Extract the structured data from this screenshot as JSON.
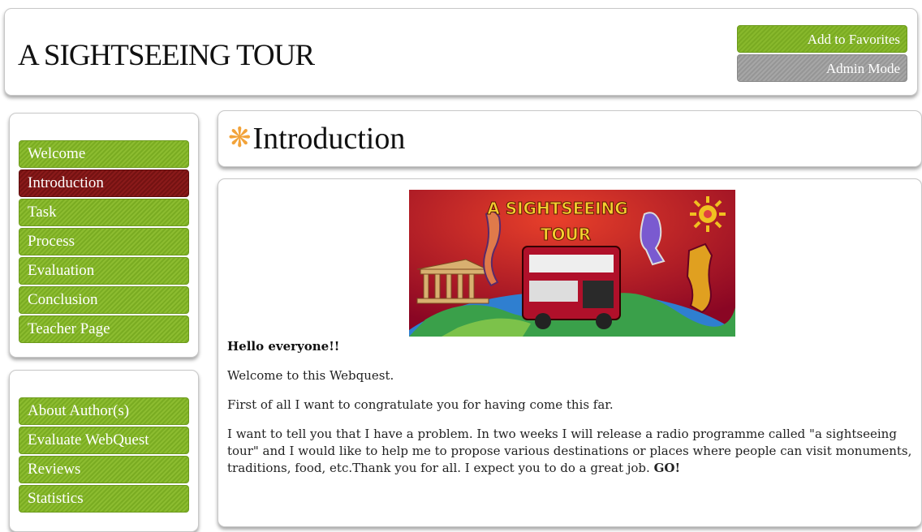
{
  "header": {
    "title": "A SIGHTSEEING TOUR",
    "add_favorites": "Add to Favorites",
    "admin_mode": "Admin Mode"
  },
  "nav_main": [
    {
      "label": "Welcome"
    },
    {
      "label": "Introduction",
      "active": true
    },
    {
      "label": "Task"
    },
    {
      "label": "Process"
    },
    {
      "label": "Evaluation"
    },
    {
      "label": "Conclusion"
    },
    {
      "label": "Teacher Page"
    }
  ],
  "nav_extra": [
    {
      "label": "About Author(s)"
    },
    {
      "label": "Evaluate WebQuest"
    },
    {
      "label": "Reviews"
    },
    {
      "label": "Statistics"
    }
  ],
  "page": {
    "heading": "Introduction",
    "banner_line1": "A SIGHTSEEING",
    "banner_line2": "TOUR"
  },
  "content": {
    "greeting": "Hello everyone!!",
    "p1": "Welcome to this Webquest.",
    "p2": "First of all I want to congratulate you for having come this far.",
    "p3": "I want to tell you that I have a problem. In two weeks I will release a radio programme called \"a sightseeing tour\" and I would like to help me to propose various destinations or places where people can visit monuments, traditions, food, etc.Thank you for all. I expect you to do a great job. ",
    "p3_bold": "GO!"
  },
  "colors": {
    "nav_green": "#7aac22",
    "nav_active": "#741212",
    "admin_gray": "#969696",
    "star_orange": "#f2a33a"
  }
}
